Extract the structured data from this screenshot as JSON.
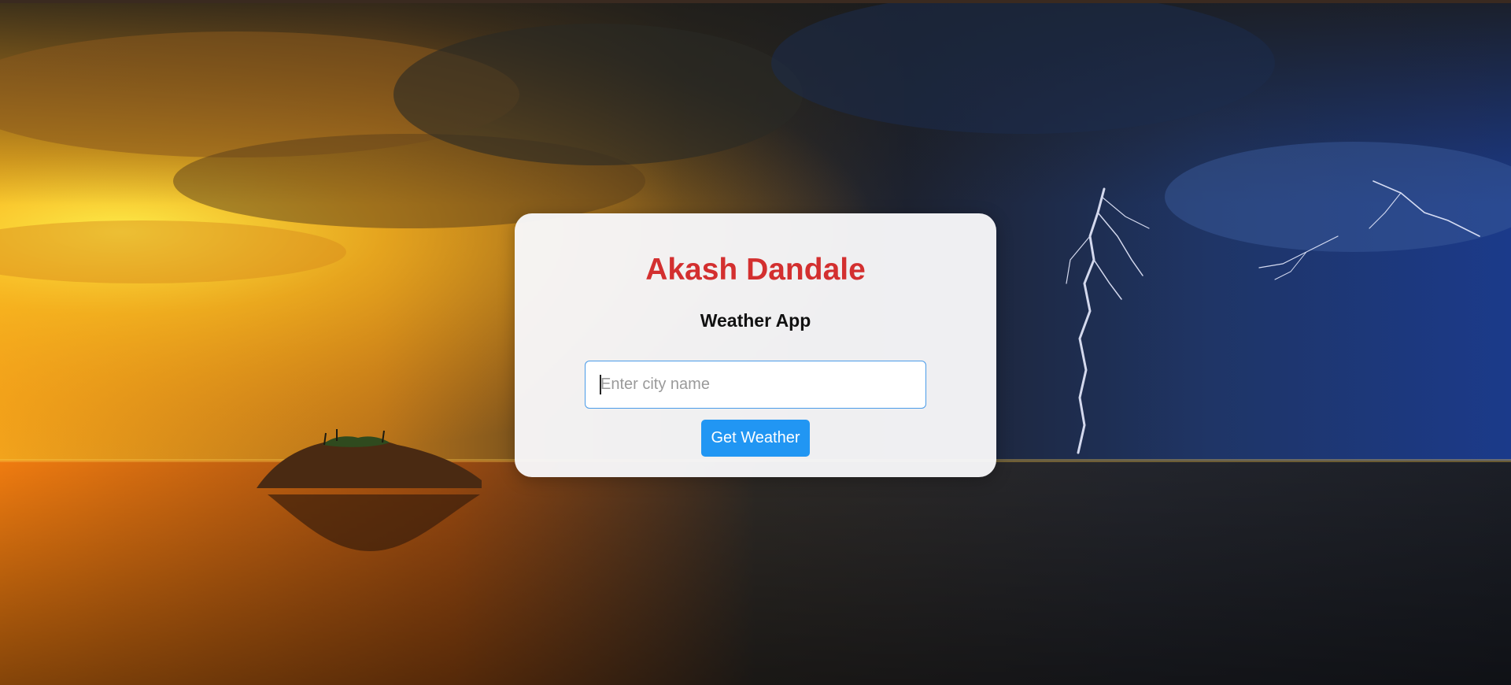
{
  "header": {
    "title": "Akash Dandale",
    "subtitle": "Weather App"
  },
  "search": {
    "placeholder": "Enter city name",
    "value": ""
  },
  "actions": {
    "submit_label": "Get Weather"
  },
  "theme": {
    "title_color": "#d32f2f",
    "button_color": "#2196f3",
    "input_border_color": "#4a9be8",
    "card_background": "#f8f8fa"
  },
  "icons": {
    "background": "sunset-storm-island-background"
  }
}
